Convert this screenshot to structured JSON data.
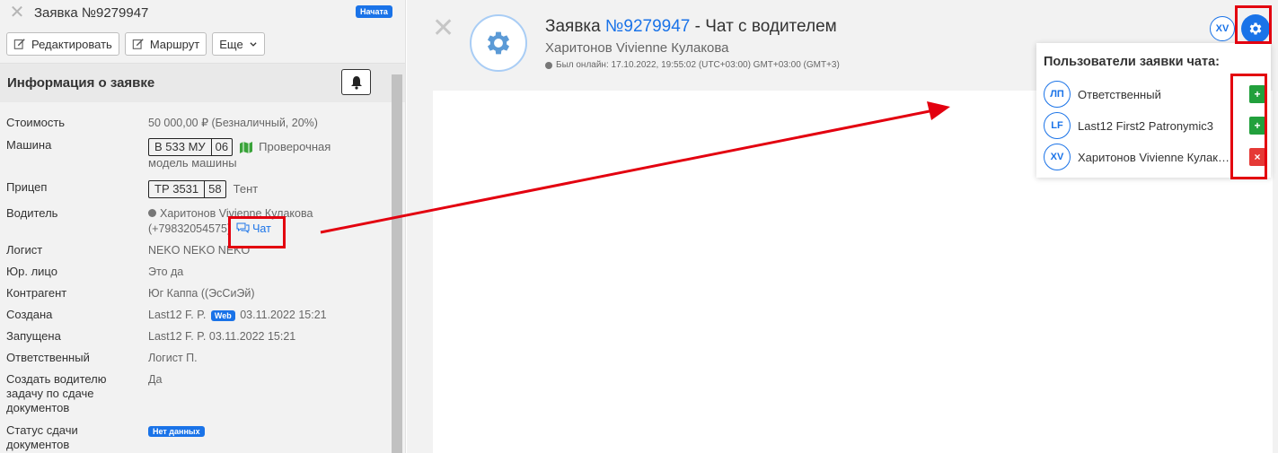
{
  "order": {
    "title": "Заявка №9279947",
    "status_badge": "Начата",
    "buttons": {
      "edit": "Редактировать",
      "route": "Маршрут",
      "more": "Еще"
    },
    "info_header": "Информация о заявке",
    "rows": {
      "cost": {
        "label": "Стоимость",
        "value": "50 000,00 ₽ (Безналичный, 20%)"
      },
      "vehicle": {
        "label": "Машина",
        "plate_number": "В 533 МУ",
        "plate_region": "06",
        "model_line1": "Проверочная",
        "model_line2": "модель машины"
      },
      "trailer": {
        "label": "Прицеп",
        "plate_number": "ТР 3531",
        "plate_region": "58",
        "type": "Тент"
      },
      "driver": {
        "label": "Водитель",
        "name": "Харитонов Vivienne Кулакова",
        "phone": "(+79832054575)",
        "chat_link": "Чат"
      },
      "logist": {
        "label": "Логист",
        "value": "NEKO NEKO NEKO"
      },
      "legal": {
        "label": "Юр. лицо",
        "value": "Это да"
      },
      "contractor": {
        "label": "Контрагент",
        "value": "Юг Каппа ((ЭсСиЭй)"
      },
      "created": {
        "label": "Создана",
        "user": "Last12 F. P.",
        "badge": "Web",
        "datetime": "03.11.2022 15:21"
      },
      "started": {
        "label": "Запущена",
        "value": "Last12 F. P. 03.11.2022 15:21"
      },
      "responsible": {
        "label": "Ответственный",
        "value": "Логист П."
      },
      "task": {
        "label_l1": "Создать водителю",
        "label_l2": "задачу по сдаче",
        "label_l3": "документов",
        "value": "Да"
      },
      "doc_status": {
        "label_l1": "Статус сдачи",
        "label_l2": "документов",
        "badge": "Нет данных"
      }
    }
  },
  "chat": {
    "title_prefix": "Заявка ",
    "title_number": "№9279947",
    "title_suffix": " - Чат с водителем",
    "subtitle": "Харитонов Vivienne Кулакова",
    "online": "Был онлайн: 17.10.2022, 19:55:02 (UTC+03:00) GMT+03:00 (GMT+3)",
    "top_avatar": "XV",
    "settings_icon": "gear-icon"
  },
  "dropdown": {
    "title": "Пользователи заявки чата:",
    "users": [
      {
        "initials": "ЛП",
        "name": "Ответственный",
        "action": "+"
      },
      {
        "initials": "LF",
        "name": "Last12 First2 Patronymic3",
        "action": "+"
      },
      {
        "initials": "XV",
        "name": "Харитонов Vivienne Кулакова",
        "action": "×"
      }
    ]
  },
  "colors": {
    "accent": "#1a73e8",
    "highlight": "#e3000f",
    "add": "#22a03c",
    "remove": "#e53935"
  }
}
